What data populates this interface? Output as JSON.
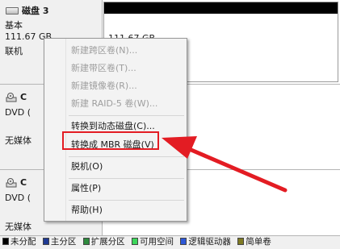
{
  "disk3": {
    "name": "磁盘 3",
    "type": "基本",
    "size": "111.67 GB",
    "status": "联机",
    "partition_size": "111.67 GB"
  },
  "cd1": {
    "name": "C",
    "type": "DVD (",
    "status": "无媒体"
  },
  "cd2": {
    "name": "C",
    "type": "DVD (",
    "status": "无媒体"
  },
  "context_menu": {
    "items": [
      {
        "label": "新建跨区卷(N)...",
        "enabled": false
      },
      {
        "label": "新建带区卷(T)...",
        "enabled": false
      },
      {
        "label": "新建镜像卷(R)...",
        "enabled": false
      },
      {
        "label": "新建 RAID-5 卷(W)...",
        "enabled": false
      },
      {
        "label": "转换到动态磁盘(C)...",
        "enabled": true
      },
      {
        "label": "转换成 MBR 磁盘(V)",
        "enabled": true
      },
      {
        "label": "脱机(O)",
        "enabled": true
      },
      {
        "label": "属性(P)",
        "enabled": true
      },
      {
        "label": "帮助(H)",
        "enabled": true
      }
    ]
  },
  "legend": [
    {
      "label": "未分配",
      "color": "#000000"
    },
    {
      "label": "主分区",
      "color": "#1f3a93"
    },
    {
      "label": "扩展分区",
      "color": "#2e8b3e"
    },
    {
      "label": "可用空间",
      "color": "#3cd65a"
    },
    {
      "label": "逻辑驱动器",
      "color": "#2d57d6"
    },
    {
      "label": "简单卷",
      "color": "#7f7a23"
    }
  ],
  "colors": {
    "annotation_red": "#e31c23"
  }
}
